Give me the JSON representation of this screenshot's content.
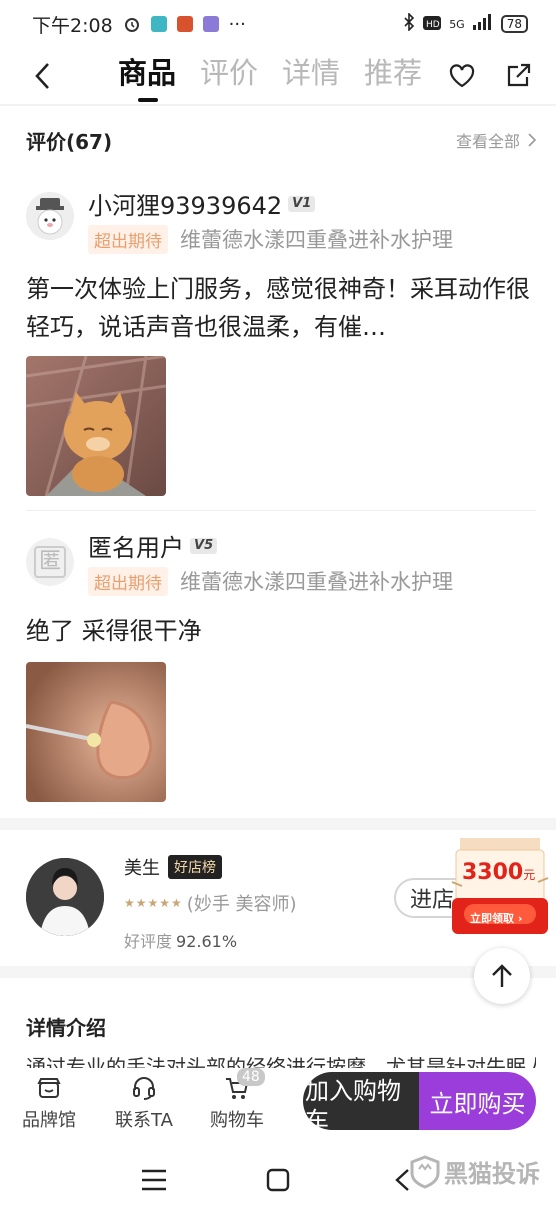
{
  "status_bar": {
    "time": "下午2:08",
    "more": "···",
    "network": "5G",
    "battery": "78"
  },
  "nav": {
    "tabs": [
      {
        "label": "商品",
        "active": true
      },
      {
        "label": "评价",
        "active": false
      },
      {
        "label": "详情",
        "active": false
      },
      {
        "label": "推荐",
        "active": false
      }
    ]
  },
  "reviews": {
    "title": "评价(67)",
    "see_all": "查看全部",
    "items": [
      {
        "user": "小河狸93939642",
        "level": "1",
        "tag": "超出期待",
        "product": "维蕾德水漾四重叠进补水护理",
        "text": "第一次体验上门服务，感觉很神奇！采耳动作很轻巧，说话声音也很温柔，有催…"
      },
      {
        "user": "匿名用户",
        "avatar_text": "匿",
        "level": "5",
        "tag": "超出期待",
        "product": "维蕾德水漾四重叠进补水护理",
        "text": "绝了  采得很干净"
      }
    ]
  },
  "shop": {
    "name": "美生",
    "badge": "好店榜",
    "role": "(妙手 美容师)",
    "rating_label": "好评度",
    "rating_value": "92.61%",
    "enter": "进店",
    "coupon_amount": "3300",
    "coupon_unit": "元",
    "coupon_action": "立即领取"
  },
  "detail": {
    "title": "详情介绍",
    "text": "通过专业的手法对头部的经络进行按摩，尤其是针对失眠人"
  },
  "bottom_bar": {
    "brand": "品牌馆",
    "contact": "联系TA",
    "cart": "购物车",
    "cart_count": "48",
    "add_to_cart": "加入购物车",
    "buy_now": "立即购买"
  },
  "watermark": "黑猫投诉",
  "colors": {
    "accent_purple": "#9b3ddb",
    "tag_orange": "#e7a070",
    "coupon_red": "#e2231a"
  }
}
